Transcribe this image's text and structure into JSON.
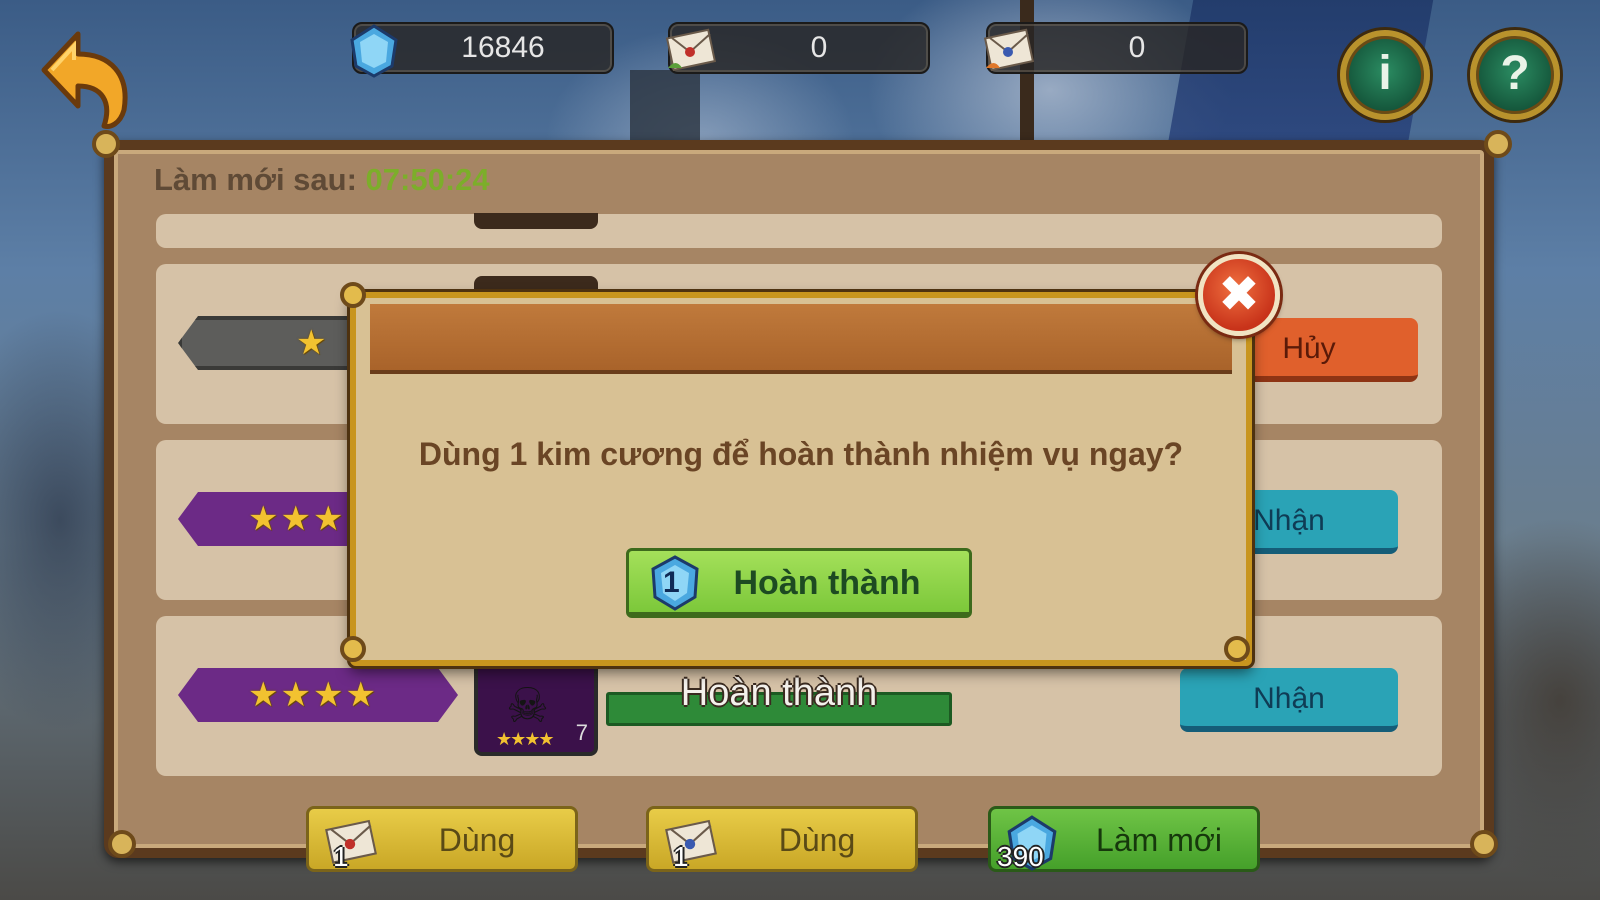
{
  "resources": [
    {
      "icon": "diamond-icon",
      "value": "16846"
    },
    {
      "icon": "letter-green-icon",
      "value": "0"
    },
    {
      "icon": "letter-orange-icon",
      "value": "0"
    }
  ],
  "top_buttons": {
    "info": "i",
    "help": "?"
  },
  "panel": {
    "refresh_label": "Làm mới sau: ",
    "refresh_time": "07:50:24"
  },
  "missions": [
    {
      "stars": "★",
      "tier": "grey",
      "action": "Hủy",
      "action_color": "orange"
    },
    {
      "stars": "★★★",
      "tier": "purple",
      "action": "Nhận",
      "action_color": "teal"
    },
    {
      "stars": "★★★★",
      "tier": "purple",
      "action": "Nhận",
      "action_color": "teal",
      "avatar_stars": "★★★★",
      "avatar_level": "7",
      "status": "Hoàn thành"
    }
  ],
  "bottom_buttons": [
    {
      "icon": "letter-green-icon",
      "count": "1",
      "label": "Dùng"
    },
    {
      "icon": "letter-orange-icon",
      "count": "1",
      "label": "Dùng"
    },
    {
      "icon": "diamond-icon",
      "count": "390",
      "label": "Làm mới"
    }
  ],
  "dialog": {
    "message": "Dùng 1 kim cương để hoàn thành nhiệm vụ ngay?",
    "confirm_cost": "1",
    "confirm_label": "Hoàn thành",
    "close_symbol": "✖"
  },
  "colors": {
    "refresh_time": "#7cae2a",
    "confirm_button": "#8fd44a",
    "close_button": "#d9472a",
    "teal_button": "#2aa3b6",
    "orange_button": "#e0602c",
    "purple_tier": "#6c2a86"
  }
}
